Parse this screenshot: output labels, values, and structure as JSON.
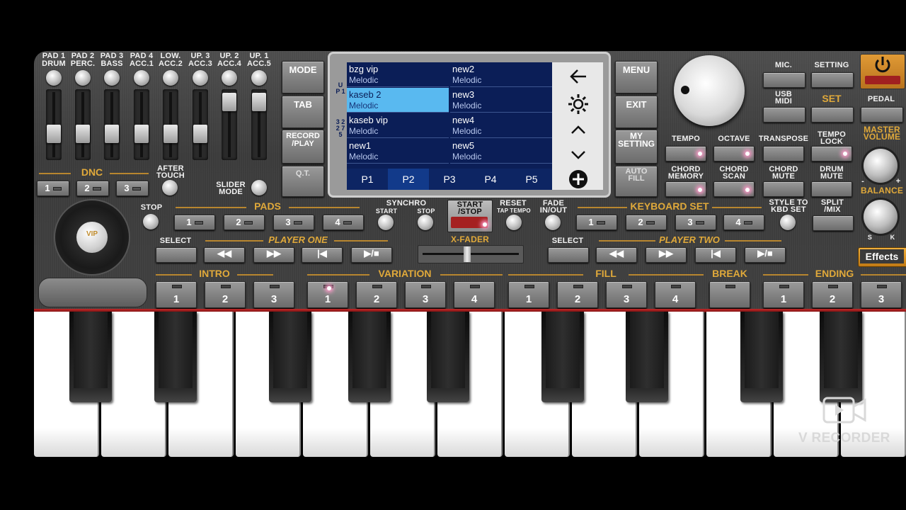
{
  "pads_top": [
    {
      "l1": "PAD 1",
      "l2": "DRUM"
    },
    {
      "l1": "PAD 2",
      "l2": "PERC."
    },
    {
      "l1": "PAD 3",
      "l2": "BASS"
    },
    {
      "l1": "PAD 4",
      "l2": "ACC.1"
    },
    {
      "l1": "LOW.",
      "l2": "ACC.2"
    },
    {
      "l1": "UP. 3",
      "l2": "ACC.3"
    },
    {
      "l1": "UP. 2",
      "l2": "ACC.4"
    },
    {
      "l1": "UP. 1",
      "l2": "ACC.5"
    }
  ],
  "dnc": {
    "title": "DNC",
    "buttons": [
      "1",
      "2",
      "3"
    ],
    "after_touch": "AFTER\nTOUCH",
    "slider_mode": "SLIDER\nMODE"
  },
  "left_menu": {
    "mode": "MODE",
    "tab": "TAB",
    "record": "RECORD\n/PLAY",
    "qt": "Q.T."
  },
  "screen": {
    "up_label": "U P 1",
    "side_label": "3 2 2 7 5",
    "cells": [
      {
        "title": "bzg vip",
        "sub": "Melodic"
      },
      {
        "title": "new2",
        "sub": "Melodic"
      },
      {
        "title": "kaseb 2",
        "sub": "Melodic"
      },
      {
        "title": "new3",
        "sub": "Melodic"
      },
      {
        "title": "kaseb vip",
        "sub": "Melodic"
      },
      {
        "title": "new4",
        "sub": "Melodic"
      },
      {
        "title": "new1",
        "sub": "Melodic"
      },
      {
        "title": "new5",
        "sub": "Melodic"
      }
    ],
    "tabs": [
      "P1",
      "P2",
      "P3",
      "P4",
      "P5"
    ],
    "active_tab": "P2"
  },
  "right_menu": {
    "menu": "MENU",
    "exit": "EXIT",
    "my_setting": "MY\nSETTING",
    "auto_fill": "AUTO\nFILL"
  },
  "top_right": {
    "mic": "MIC.",
    "setting": "SETTING",
    "usb_midi": "USB\nMIDI",
    "set": "SET",
    "pedal": "PEDAL"
  },
  "funcs": {
    "tempo": "TEMPO",
    "octave": "OCTAVE",
    "transpose": "TRANSPOSE",
    "tempo_lock": "TEMPO\nLOCK",
    "chord_memory": "CHORD\nMEMORY",
    "chord_scan": "CHORD\nSCAN",
    "chord_mute": "CHORD\nMUTE",
    "drum_mute": "DRUM\nMUTE",
    "master_volume": "MASTER\nVOLUME",
    "balance": "BALANCE",
    "bal_s": "S",
    "bal_k": "K",
    "minus": "-",
    "plus": "+"
  },
  "row_pads": {
    "stop": "STOP",
    "pads": "PADS",
    "pad_buttons": [
      "1",
      "2",
      "3",
      "4"
    ],
    "synchro": "SYNCHRO",
    "sync_start": "START",
    "sync_stop": "STOP",
    "start_stop": "START\n/STOP",
    "reset": "RESET",
    "tap_tempo": "TAP TEMPO",
    "fade": "FADE\nIN/OUT",
    "keyboard_set": "KEYBOARD SET",
    "kb_buttons": [
      "1",
      "2",
      "3",
      "4"
    ],
    "style_to_kbd": "STYLE TO\nKBD SET",
    "split": "SPLIT\n/MIX"
  },
  "players": {
    "select": "SELECT",
    "player_one": "PLAYER ONE",
    "xfader": "X-FADER",
    "player_two": "PLAYER TWO"
  },
  "effects": "Effects",
  "sections": {
    "intro": "INTRO",
    "intro_buttons": [
      "1",
      "2",
      "3"
    ],
    "variation": "VARIATION",
    "variation_buttons": [
      "1",
      "2",
      "3",
      "4"
    ],
    "fill": "FILL",
    "fill_buttons": [
      "1",
      "2",
      "3",
      "4"
    ],
    "break": "BREAK",
    "ending": "ENDING",
    "ending_buttons": [
      "1",
      "2",
      "3"
    ]
  },
  "vip_label": "VIP",
  "watermark": "V RECORDER"
}
